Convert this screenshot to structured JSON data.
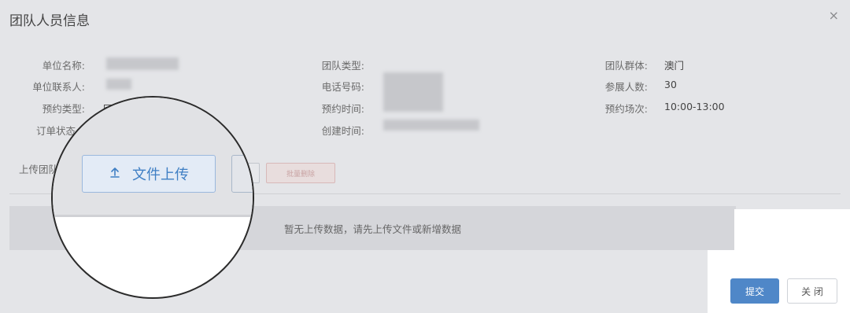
{
  "dialog": {
    "title": "团队人员信息",
    "close_glyph": "×"
  },
  "info": {
    "unit_name_label": "单位名称:",
    "unit_contact_label": "单位联系人:",
    "booking_type_label": "预约类型:",
    "booking_type_value_partial": "团",
    "order_status_label": "订单状态",
    "team_type_label": "团队类型:",
    "phone_label": "电话号码:",
    "booking_time_label": "预约时间:",
    "created_time_label": "创建时间:",
    "team_group_label": "团队群体:",
    "team_group_value": "澳门",
    "visitor_count_label": "参展人数:",
    "visitor_count_value": "30",
    "session_label": "预约场次:",
    "session_value": "10:00-13:00"
  },
  "upload": {
    "label_partial": "上传团队",
    "file_upload_label": "文件上传",
    "batch_delete_label": "批量删除"
  },
  "table": {
    "empty_text": "暂无上传数据，请先上传文件或新增数据"
  },
  "footer": {
    "submit_label": "提交",
    "close_label": "关 闭"
  }
}
